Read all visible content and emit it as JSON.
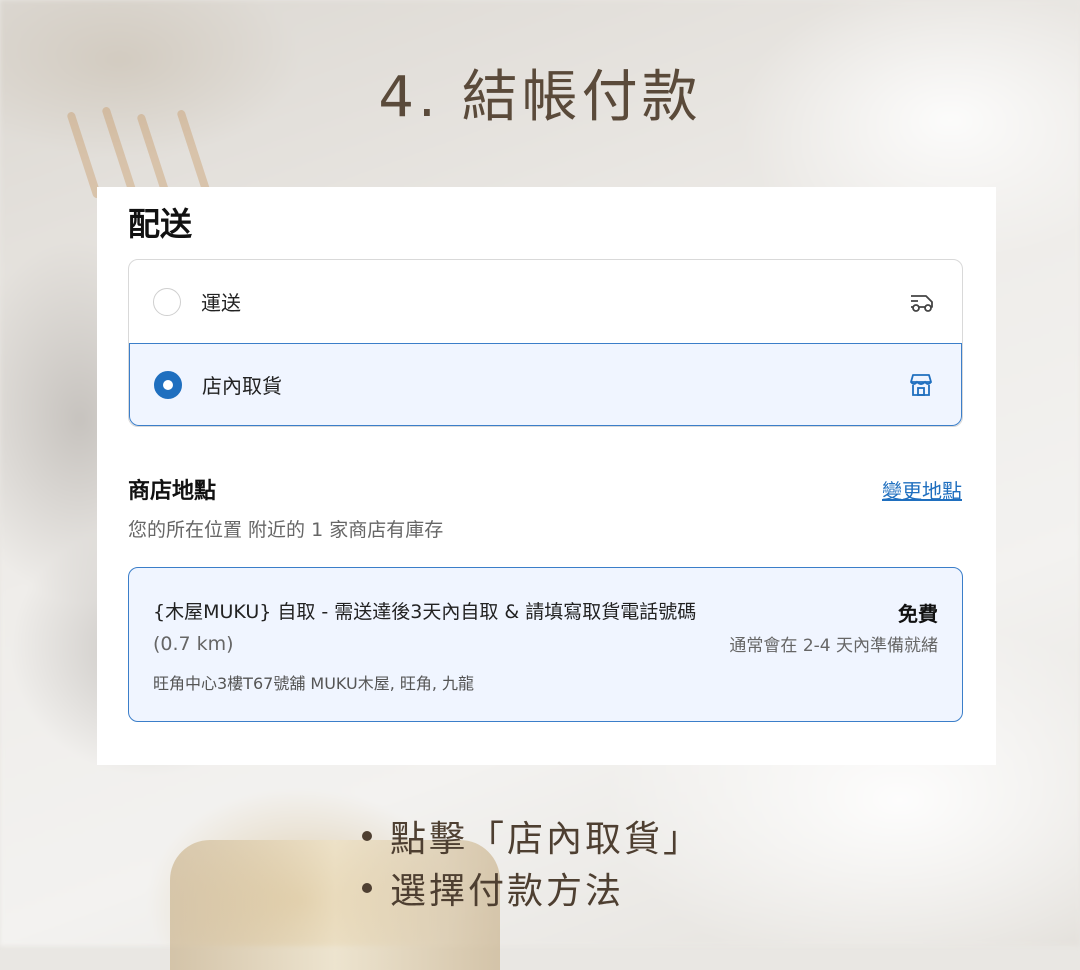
{
  "title": "4. 結帳付款",
  "delivery": {
    "heading": "配送",
    "options": [
      {
        "label": "運送",
        "icon": "delivery-truck-icon",
        "selected": false
      },
      {
        "label": "店內取貨",
        "icon": "storefront-icon",
        "selected": true
      }
    ]
  },
  "store": {
    "heading": "商店地點",
    "change_link": "變更地點",
    "availability": "您的所在位置 附近的 1 家商店有庫存",
    "card": {
      "name": "{木屋MUKU} 自取 - 需送達後3天內自取 & 請填寫取貨電話號碼",
      "distance": "(0.7 km)",
      "address": "旺角中心3樓T67號舖 MUKU木屋, 旺角, 九龍",
      "price": "免費",
      "ready_time": "通常會在 2-4 天內準備就緒"
    }
  },
  "instructions": [
    "點擊「店內取貨」",
    "選擇付款方法"
  ],
  "colors": {
    "accent": "#1f6fbf",
    "selected_bg": "#f0f5ff",
    "title_text": "#5a4a3a"
  }
}
